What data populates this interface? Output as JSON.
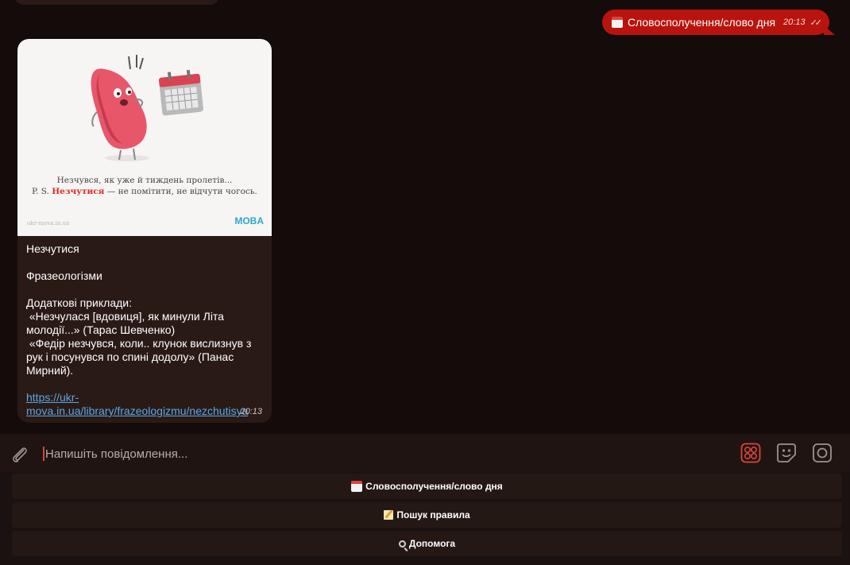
{
  "outgoing": {
    "text": "Словосполучення/слово дня",
    "time": "20:13",
    "icon": "calendar-icon",
    "bubble_color": "#b8140d"
  },
  "incoming": {
    "image": {
      "line1": "Незчувся, як уже й тиждень пролетів...",
      "line2_prefix": "P. S. ",
      "line2_highlight": "Незчутися",
      "line2_rest": " — не помітити, не відчути чогось.",
      "site": "ukr-mova.in.ua",
      "logo": "MOBA"
    },
    "body": "Незчутися\n\nФразеологізми\n\nДодаткові приклади:\n «Незчулася [вдовиця], як минули Літа молодії...» (Тарас Шевченко)\n «Федір незчувся, коли.. клунок вислизнув з рук і посунувся по спині додолу» (Панас Мирний).\n\n",
    "link": "https://ukr-mova.in.ua/library/frazeologizmu/nezchutisya",
    "time": "20:13"
  },
  "composer": {
    "placeholder": "Напишіть повідомлення...",
    "accent": "#d9453d"
  },
  "keyboard": [
    {
      "label": "Словосполучення/слово дня",
      "icon": "calendar-icon"
    },
    {
      "label": "Пошук правила",
      "icon": "memo-icon"
    },
    {
      "label": "Допомога",
      "icon": "magnifier-icon"
    }
  ]
}
